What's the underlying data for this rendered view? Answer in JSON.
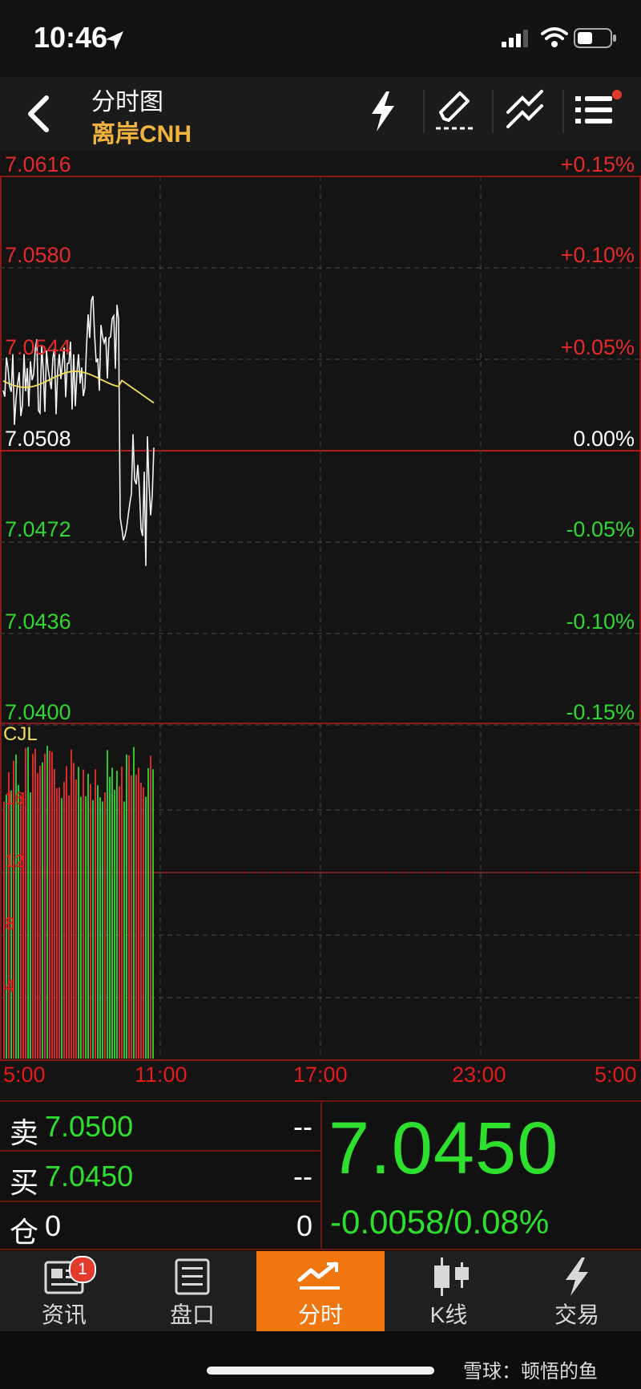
{
  "status_bar": {
    "time": "10:46"
  },
  "header": {
    "title": "分时图",
    "subtitle": "离岸CNH"
  },
  "chart": {
    "price_labels": [
      {
        "text": "7.0616",
        "color": "#e52a2a"
      },
      {
        "text": "7.0580",
        "color": "#e52a2a"
      },
      {
        "text": "7.0544",
        "color": "#e52a2a"
      },
      {
        "text": "7.0508",
        "color": "#ffffff"
      },
      {
        "text": "7.0472",
        "color": "#31d631"
      },
      {
        "text": "7.0436",
        "color": "#31d631"
      },
      {
        "text": "7.0400",
        "color": "#31d631"
      }
    ],
    "pct_labels": [
      {
        "text": "+0.15%",
        "color": "#e52a2a"
      },
      {
        "text": "+0.10%",
        "color": "#e52a2a"
      },
      {
        "text": "+0.05%",
        "color": "#e52a2a"
      },
      {
        "text": "0.00%",
        "color": "#ffffff"
      },
      {
        "text": "-0.05%",
        "color": "#31d631"
      },
      {
        "text": "-0.10%",
        "color": "#31d631"
      },
      {
        "text": "-0.15%",
        "color": "#31d631"
      }
    ],
    "volume_label": "CJL",
    "volume_axis": [
      "16",
      "12",
      "8",
      "4"
    ],
    "time_labels": [
      "5:00",
      "11:00",
      "17:00",
      "23:00",
      "5:00"
    ]
  },
  "quote": {
    "sell_label": "卖",
    "sell_price": "7.0500",
    "sell_vol": "--",
    "buy_label": "买",
    "buy_price": "7.0450",
    "buy_vol": "--",
    "pos_label": "仓",
    "pos_value": "0",
    "pos_right": "0",
    "last_price": "7.0450",
    "change": "-0.0058/0.08%"
  },
  "tabs": [
    {
      "label": "资讯",
      "icon": "news-icon",
      "badge": "1"
    },
    {
      "label": "盘口",
      "icon": "order-book-icon"
    },
    {
      "label": "分时",
      "icon": "timeshare-icon",
      "active": true
    },
    {
      "label": "K线",
      "icon": "candlestick-icon"
    },
    {
      "label": "交易",
      "icon": "trade-lightning-icon"
    }
  ],
  "watermark": "雪球：顿悟的鱼",
  "colors": {
    "up": "#e52a2a",
    "down": "#31d631",
    "accent": "#f07710",
    "subtitle": "#f2b33c",
    "avg_line": "#f1e05a"
  }
}
